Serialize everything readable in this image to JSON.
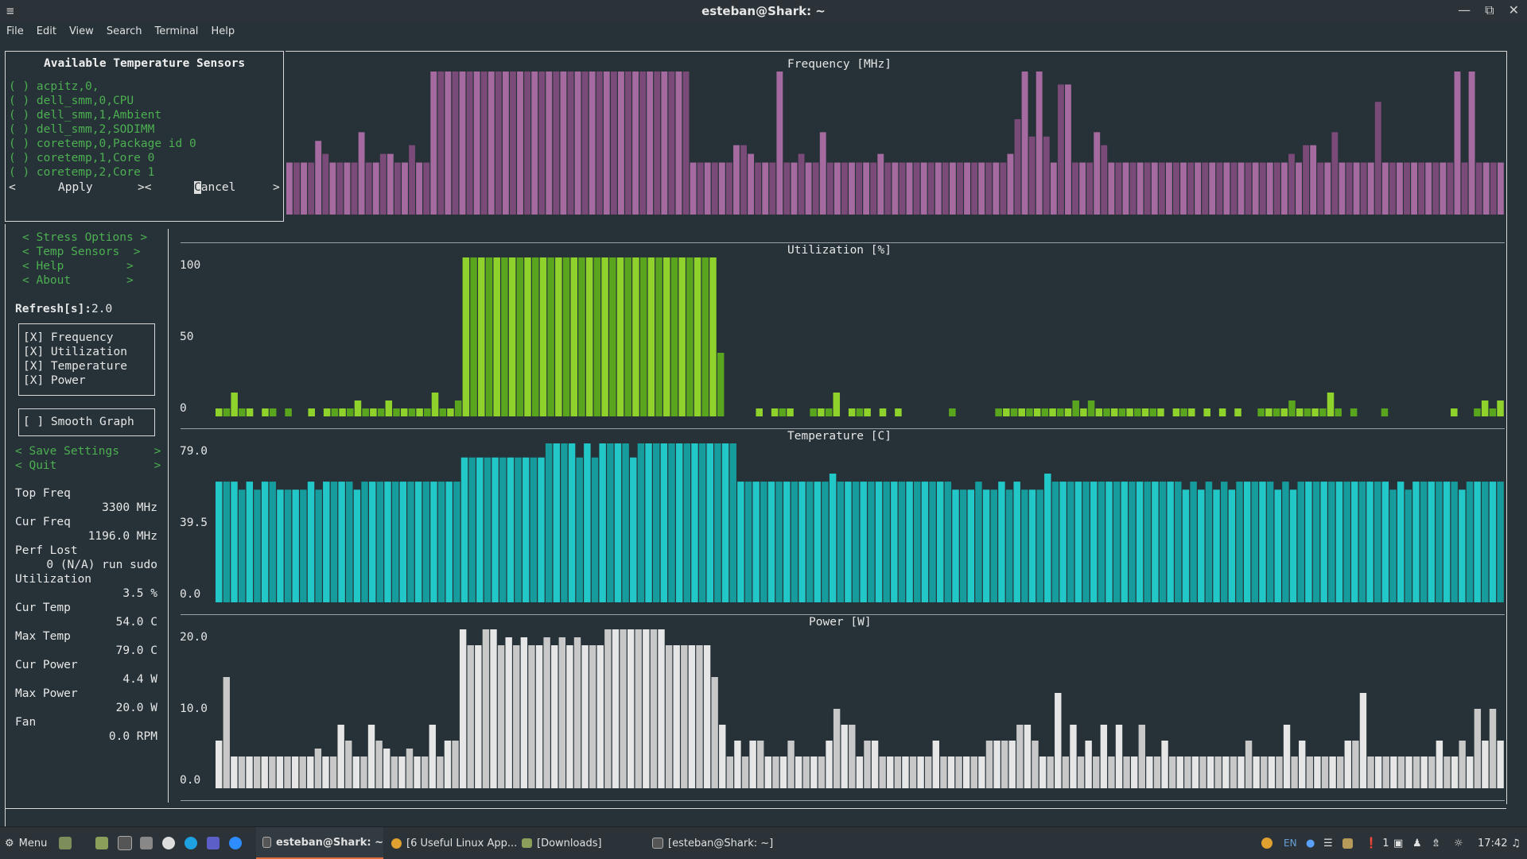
{
  "window": {
    "title": "esteban@Shark: ~",
    "menu": [
      "File",
      "Edit",
      "View",
      "Search",
      "Terminal",
      "Help"
    ]
  },
  "sensors": {
    "title": "Available Temperature Sensors",
    "items": [
      "( ) acpitz,0,",
      "( ) dell_smm,0,CPU",
      "( ) dell_smm,1,Ambient",
      "( ) dell_smm,2,SODIMM",
      "( ) coretemp,0,Package id 0",
      "( ) coretemp,1,Core 0",
      "( ) coretemp,2,Core 1"
    ],
    "apply": "Apply",
    "cancel": "Cancel"
  },
  "sidebar": {
    "menu": [
      "Stress Options",
      "Temp Sensors",
      "Help",
      "About"
    ],
    "refresh_label": "Refresh[s]:",
    "refresh_value": "2.0",
    "checks": [
      "[X] Frequency",
      "[X] Utilization",
      "[X] Temperature",
      "[X] Power"
    ],
    "smooth": "[ ] Smooth Graph",
    "save": "Save Settings",
    "quit": "Quit",
    "stats": [
      {
        "label": "Top Freq",
        "value": "3300 MHz"
      },
      {
        "label": "Cur Freq",
        "value": "1196.0 MHz"
      },
      {
        "label": "Perf Lost",
        "value": "0 (N/A) run sudo"
      },
      {
        "label": "Utilization",
        "value": "3.5 %"
      },
      {
        "label": "Cur Temp",
        "value": "54.0 C"
      },
      {
        "label": "Max Temp",
        "value": "79.0 C"
      },
      {
        "label": "Cur Power",
        "value": "4.4 W"
      },
      {
        "label": "Max Power",
        "value": "20.0 W"
      },
      {
        "label": "Fan",
        "value": "0.0 RPM"
      }
    ]
  },
  "chart_data": [
    {
      "type": "bar",
      "title": "Frequency [MHz]",
      "ylim": [
        0,
        3300
      ],
      "colors": [
        "#a56aa0",
        "#7a4a78"
      ],
      "values": [
        1200,
        1200,
        1200,
        1200,
        1700,
        1400,
        1200,
        1200,
        1200,
        1200,
        1900,
        1200,
        1200,
        1400,
        1400,
        1200,
        1200,
        1600,
        1200,
        1200,
        3300,
        3300,
        3300,
        3300,
        3300,
        3300,
        3300,
        3300,
        3300,
        3300,
        3300,
        3300,
        3300,
        3300,
        3300,
        3300,
        3300,
        3300,
        3300,
        3300,
        3300,
        3300,
        3300,
        3300,
        3300,
        3300,
        3300,
        3300,
        3300,
        3300,
        3300,
        3300,
        3300,
        3300,
        3300,
        3300,
        1200,
        1200,
        1200,
        1200,
        1200,
        1200,
        1600,
        1600,
        1400,
        1200,
        1200,
        1200,
        3300,
        1200,
        1200,
        1400,
        1200,
        1200,
        1900,
        1200,
        1200,
        1200,
        1200,
        1200,
        1200,
        1200,
        1400,
        1200,
        1200,
        1200,
        1200,
        1200,
        1200,
        1200,
        1200,
        1200,
        1200,
        1200,
        1200,
        1200,
        1200,
        1200,
        1200,
        1200,
        1400,
        2200,
        3300,
        1800,
        3300,
        1800,
        1200,
        3000,
        3000,
        1200,
        1200,
        1200,
        1900,
        1600,
        1200,
        1200,
        1200,
        1200,
        1200,
        1200,
        1200,
        1200,
        1200,
        1200,
        1200,
        1200,
        1200,
        1200,
        1200,
        1200,
        1200,
        1200,
        1200,
        1200,
        1200,
        1200,
        1200,
        1200,
        1200,
        1400,
        1200,
        1600,
        1600,
        1200,
        1200,
        1900,
        1200,
        1200,
        1200,
        1200,
        1200,
        2600,
        1200,
        1200,
        1200,
        1200,
        1200,
        1200,
        1200,
        1200,
        1200,
        1200,
        3600,
        1200,
        3300,
        1200,
        1200,
        1200,
        1200
      ]
    },
    {
      "type": "bar",
      "title": "Utilization [%]",
      "yticks": [
        "100",
        "50",
        "0"
      ],
      "ylim": [
        0,
        100
      ],
      "colors": [
        "#8fd22c",
        "#5aa51e"
      ],
      "values": [
        5,
        5,
        15,
        5,
        5,
        0,
        5,
        5,
        0,
        5,
        0,
        0,
        5,
        0,
        5,
        5,
        5,
        5,
        10,
        5,
        5,
        5,
        10,
        5,
        5,
        5,
        5,
        5,
        15,
        5,
        5,
        10,
        100,
        100,
        100,
        100,
        100,
        100,
        100,
        100,
        100,
        100,
        100,
        100,
        100,
        100,
        100,
        100,
        100,
        100,
        100,
        100,
        100,
        100,
        100,
        100,
        100,
        100,
        100,
        100,
        100,
        100,
        100,
        100,
        100,
        40,
        0,
        0,
        0,
        0,
        5,
        0,
        5,
        5,
        5,
        0,
        0,
        5,
        5,
        5,
        15,
        0,
        5,
        5,
        5,
        0,
        5,
        0,
        5,
        0,
        0,
        0,
        0,
        0,
        0,
        5,
        0,
        0,
        0,
        0,
        0,
        5,
        5,
        5,
        5,
        5,
        5,
        5,
        5,
        5,
        5,
        10,
        5,
        10,
        5,
        5,
        5,
        5,
        5,
        5,
        5,
        5,
        5,
        0,
        5,
        5,
        5,
        0,
        5,
        0,
        5,
        0,
        5,
        0,
        0,
        5,
        5,
        5,
        5,
        10,
        5,
        5,
        5,
        5,
        15,
        5,
        0,
        5,
        0,
        0,
        0,
        5,
        0,
        0,
        0,
        0,
        0,
        0,
        0,
        0,
        5,
        0,
        0,
        5,
        10,
        5,
        10
      ]
    },
    {
      "type": "bar",
      "title": "Temperature [C]",
      "yticks": [
        "79.0",
        "39.5",
        "0.0"
      ],
      "ylim": [
        0,
        79
      ],
      "colors": [
        "#22c7c7",
        "#169c9c"
      ],
      "values": [
        60,
        60,
        60,
        56,
        60,
        56,
        60,
        60,
        56,
        56,
        56,
        56,
        60,
        56,
        60,
        60,
        60,
        60,
        56,
        60,
        60,
        60,
        60,
        60,
        60,
        60,
        60,
        60,
        60,
        60,
        60,
        60,
        72,
        72,
        72,
        72,
        72,
        72,
        72,
        72,
        72,
        72,
        72,
        79,
        79,
        79,
        79,
        72,
        79,
        72,
        79,
        79,
        79,
        79,
        72,
        79,
        79,
        79,
        79,
        79,
        79,
        79,
        79,
        79,
        79,
        79,
        79,
        79,
        60,
        60,
        60,
        60,
        60,
        60,
        60,
        60,
        60,
        60,
        60,
        60,
        64,
        60,
        60,
        60,
        60,
        60,
        60,
        60,
        60,
        60,
        60,
        60,
        60,
        60,
        60,
        60,
        56,
        56,
        56,
        60,
        56,
        56,
        60,
        56,
        60,
        56,
        56,
        56,
        64,
        60,
        60,
        60,
        60,
        60,
        60,
        60,
        60,
        60,
        60,
        60,
        60,
        60,
        60,
        60,
        60,
        60,
        56,
        60,
        56,
        60,
        56,
        60,
        56,
        60,
        60,
        60,
        60,
        60,
        56,
        60,
        56,
        60,
        60,
        60,
        60,
        60,
        60,
        60,
        60,
        60,
        60,
        60,
        60,
        56,
        60,
        56,
        60,
        60,
        60,
        60,
        60,
        60,
        56,
        60,
        60,
        60,
        60,
        60
      ]
    },
    {
      "type": "bar",
      "title": "Power [W]",
      "yticks": [
        "20.0",
        "10.0",
        "0.0"
      ],
      "ylim": [
        0,
        20
      ],
      "colors": [
        "#e6e6e6",
        "#c8c8c8"
      ],
      "values": [
        6,
        14,
        4,
        4,
        4,
        4,
        4,
        4,
        4,
        4,
        4,
        4,
        4,
        5,
        4,
        4,
        8,
        6,
        4,
        4,
        8,
        6,
        5,
        4,
        4,
        5,
        4,
        4,
        8,
        4,
        6,
        6,
        20,
        18,
        18,
        20,
        21,
        18,
        19,
        18,
        19,
        18,
        18,
        19,
        18,
        19,
        18,
        19,
        18,
        18,
        18,
        20,
        20,
        20,
        20,
        20,
        20,
        20,
        20,
        18,
        18,
        18,
        18,
        18,
        18,
        14,
        8,
        4,
        6,
        4,
        6,
        6,
        4,
        4,
        4,
        6,
        4,
        4,
        4,
        4,
        6,
        10,
        8,
        8,
        4,
        6,
        6,
        4,
        4,
        4,
        4,
        4,
        4,
        4,
        6,
        4,
        4,
        4,
        4,
        4,
        4,
        6,
        6,
        6,
        6,
        8,
        8,
        6,
        4,
        4,
        12,
        4,
        8,
        4,
        6,
        4,
        8,
        4,
        8,
        4,
        4,
        8,
        4,
        4,
        6,
        4,
        4,
        4,
        4,
        4,
        4,
        4,
        4,
        4,
        4,
        6,
        4,
        4,
        4,
        4,
        8,
        4,
        6,
        4,
        4,
        4,
        4,
        4,
        6,
        6,
        12,
        4,
        4,
        4,
        4,
        4,
        4,
        4,
        4,
        4,
        6,
        4,
        4,
        6,
        4,
        10,
        6,
        10,
        6
      ]
    }
  ],
  "taskbar": {
    "menu": "Menu",
    "tasks": [
      "esteban@Shark: ~",
      "[6 Useful Linux App...",
      "[Downloads]",
      "[esteban@Shark: ~]"
    ],
    "lang": "EN",
    "notif": "1",
    "time": "17:42"
  }
}
